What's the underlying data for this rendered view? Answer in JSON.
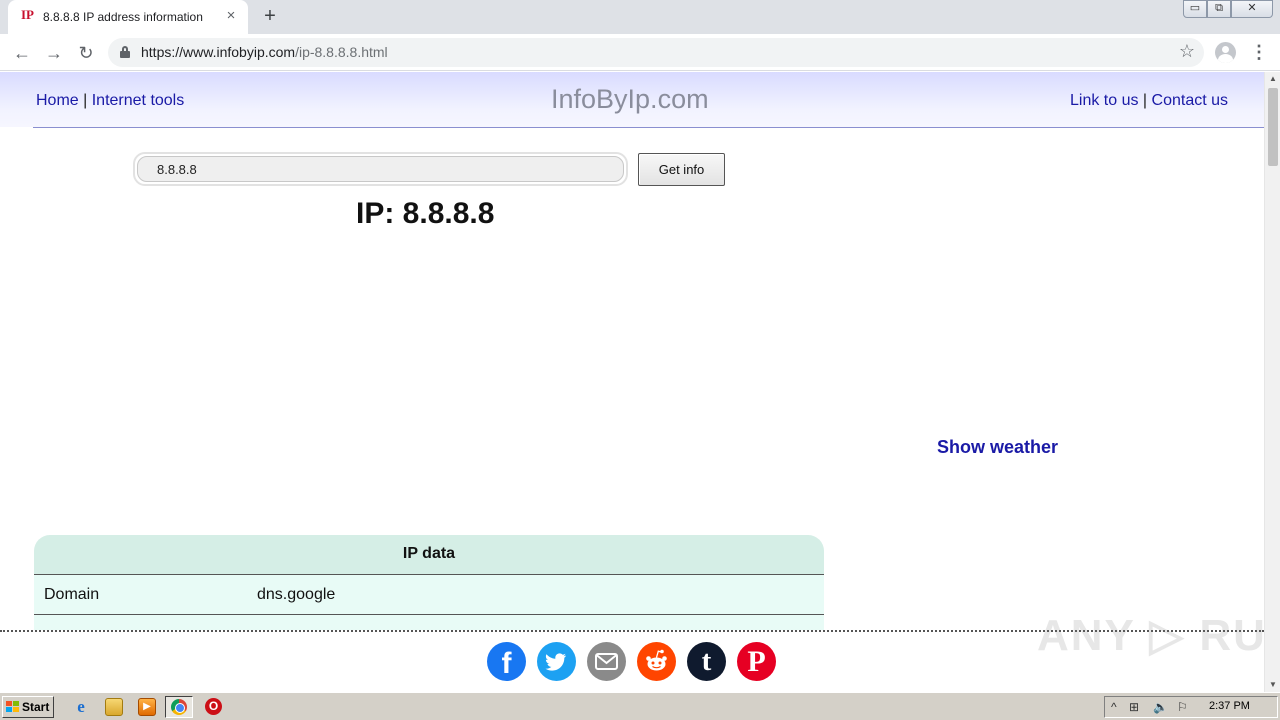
{
  "browser": {
    "tab": {
      "favicon_text": "IP",
      "title": "8.8.8.8 IP address information",
      "close_glyph": "×"
    },
    "new_tab_glyph": "+",
    "window_buttons": {
      "minimize": "▭",
      "maximize": "⧉",
      "close": "✕"
    },
    "nav": {
      "back": "←",
      "forward": "→",
      "reload": "↻"
    },
    "address": {
      "host": "https://www.infobyip.com",
      "path": "/ip-8.8.8.8.html"
    },
    "star_glyph": "☆",
    "menu_glyph": "⋮"
  },
  "site": {
    "nav_left": {
      "home": "Home",
      "sep": " | ",
      "tools": "Internet tools"
    },
    "logo": "InfoByIp.com",
    "nav_right": {
      "link": "Link to us",
      "sep": " | ",
      "contact": "Contact us"
    },
    "search": {
      "value": "8.8.8.8",
      "button": "Get info"
    },
    "ip_title": "IP: 8.8.8.8",
    "weather_link": "Show weather",
    "ip_table": {
      "header": "IP data",
      "rows": [
        {
          "key": "Domain",
          "value": "dns.google"
        }
      ]
    },
    "share": {
      "facebook": "f",
      "tumblr": "t",
      "pinterest": "P"
    },
    "watermark": "ANY ▷ RUN"
  },
  "scrollbar": {
    "up": "▲",
    "down": "▼"
  },
  "taskbar": {
    "start": "Start",
    "media_glyph": "▶",
    "ie_glyph": "e",
    "opera_glyph": "O",
    "tray": {
      "expand": "^",
      "network": "⊞",
      "volume": "🔈",
      "flag": "⚐"
    },
    "clock": "2:37 PM"
  }
}
